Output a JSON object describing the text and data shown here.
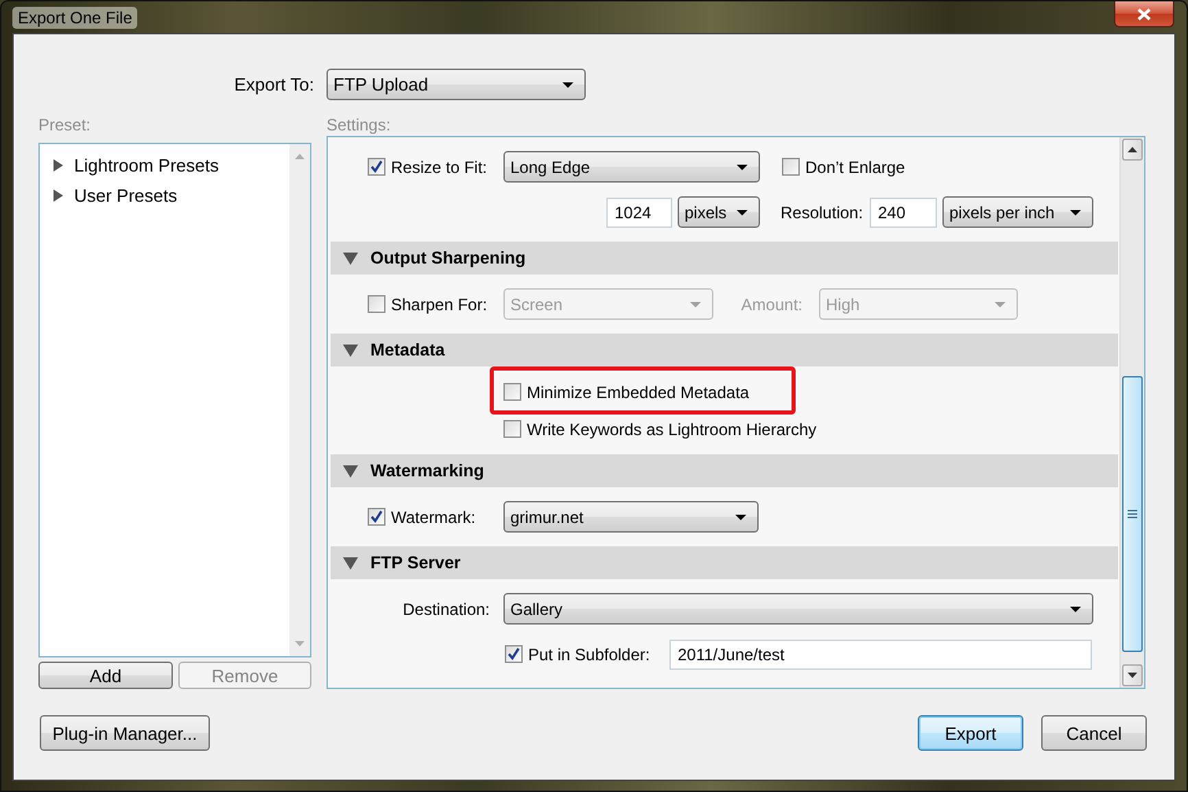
{
  "window": {
    "title": "Export One File"
  },
  "export_to": {
    "label": "Export To:",
    "value": "FTP Upload"
  },
  "preset": {
    "label": "Preset:",
    "items": [
      {
        "label": "Lightroom Presets",
        "expanded": false
      },
      {
        "label": "User Presets",
        "expanded": false
      }
    ],
    "buttons": [
      {
        "label": "Add",
        "disabled": false
      },
      {
        "label": "Remove",
        "disabled": true
      }
    ]
  },
  "settings": {
    "label": "Settings:",
    "sections": [
      {
        "rows": [
          {
            "controls": [
              {
                "kind": "checkbox",
                "label": "Resize to Fit:",
                "checked": true
              },
              {
                "kind": "select",
                "value": "Long Edge",
                "disabled": false
              },
              {
                "kind": "checkbox",
                "label": "Don’t Enlarge",
                "checked": false
              }
            ]
          },
          {
            "controls": [
              {
                "kind": "input",
                "value": "1024"
              },
              {
                "kind": "select",
                "value": "pixels",
                "disabled": false
              },
              {
                "kind": "label",
                "text": "Resolution:",
                "disabled": false
              },
              {
                "kind": "input",
                "value": "240"
              },
              {
                "kind": "select",
                "value": "pixels per inch",
                "disabled": false
              }
            ]
          }
        ]
      },
      {
        "title": "Output Sharpening",
        "expanded": true,
        "rows": [
          {
            "controls": [
              {
                "kind": "checkbox",
                "label": "Sharpen For:",
                "checked": false
              },
              {
                "kind": "select",
                "value": "Screen",
                "disabled": true
              },
              {
                "kind": "label",
                "text": "Amount:",
                "disabled": true
              },
              {
                "kind": "select",
                "value": "High",
                "disabled": true
              }
            ]
          }
        ]
      },
      {
        "title": "Metadata",
        "expanded": true,
        "rows": [
          {
            "controls": [
              {
                "kind": "checkbox",
                "label": "Minimize Embedded Metadata",
                "checked": false,
                "highlighted": true
              }
            ]
          },
          {
            "controls": [
              {
                "kind": "checkbox",
                "label": "Write Keywords as Lightroom Hierarchy",
                "checked": false,
                "highlighted": false
              }
            ]
          }
        ]
      },
      {
        "title": "Watermarking",
        "expanded": true,
        "rows": [
          {
            "controls": [
              {
                "kind": "checkbox",
                "label": "Watermark:",
                "checked": true
              },
              {
                "kind": "select",
                "value": "grimur.net",
                "disabled": false
              }
            ]
          }
        ]
      },
      {
        "title": "FTP Server",
        "expanded": true,
        "rows": [
          {
            "label": "Destination:",
            "controls": [
              {
                "kind": "select",
                "value": "Gallery",
                "disabled": false
              }
            ]
          },
          {
            "controls": [
              {
                "kind": "checkbox",
                "label": "Put in Subfolder:",
                "checked": true
              },
              {
                "kind": "input",
                "value": "2011/June/test"
              }
            ]
          }
        ]
      }
    ]
  },
  "footer": {
    "buttons": [
      {
        "label": "Plug-in Manager...",
        "default": false
      },
      {
        "label": "Export",
        "default": true
      },
      {
        "label": "Cancel",
        "default": false
      }
    ]
  }
}
